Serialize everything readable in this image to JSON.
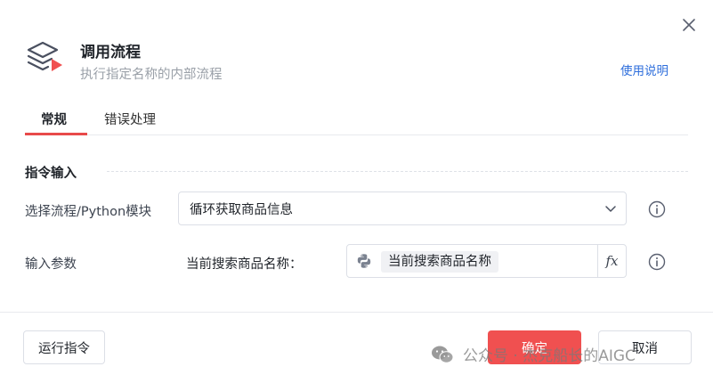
{
  "dialog": {
    "title": "调用流程",
    "subtitle": "执行指定名称的内部流程",
    "help_link": "使用说明"
  },
  "tabs": [
    {
      "label": "常规",
      "active": true
    },
    {
      "label": "错误处理",
      "active": false
    }
  ],
  "section": {
    "title": "指令输入"
  },
  "fields": {
    "flow_select": {
      "label": "选择流程/Python模块",
      "value": "循环获取商品信息"
    },
    "input_params": {
      "label": "输入参数",
      "param_name": "当前搜索商品名称：",
      "param_value": "当前搜索商品名称"
    }
  },
  "footer": {
    "run_button": "运行指令",
    "ok_button": "确定",
    "cancel_button": "取消"
  },
  "watermark": {
    "text": "公众号 · 杰克船长的AIGC"
  },
  "colors": {
    "accent_red": "#f05050",
    "link_blue": "#2f6fdc",
    "tab_underline": "#e84a4a"
  },
  "icons": {
    "header": "layers-play-icon",
    "close": "close-icon",
    "chevron": "chevron-down-icon",
    "info": "info-icon",
    "python": "python-icon",
    "fx": "fx-icon",
    "wechat": "wechat-icon"
  }
}
